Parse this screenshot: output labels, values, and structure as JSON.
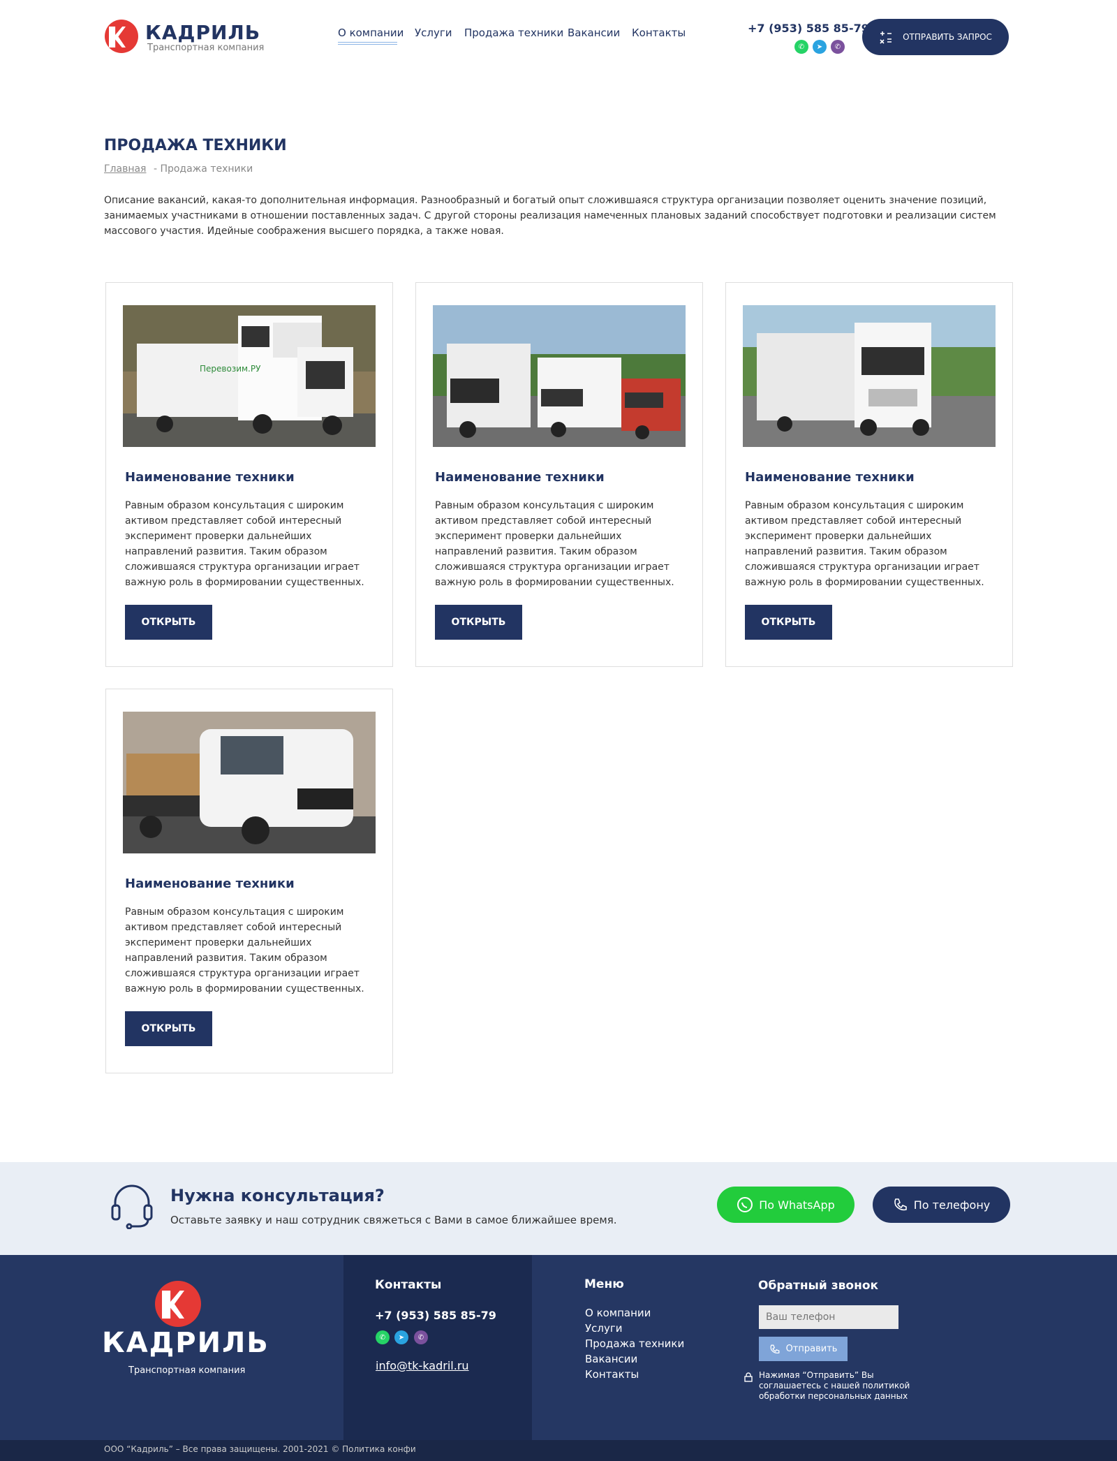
{
  "header": {
    "logo_name": "КАДРИЛЬ",
    "logo_subtitle": "Транспортная компания",
    "nav": [
      "О компании",
      "Услуги",
      "Продажа техники",
      "Вакансии",
      "Контакты"
    ],
    "phone": "+7 (953) 585 85-79",
    "request_button": "ОТПРАВИТЬ ЗАПРОС"
  },
  "page": {
    "title": "ПРОДАЖА ТЕХНИКИ",
    "breadcrumb_home": "Главная",
    "breadcrumb_current": "- Продажа техники",
    "intro": "Описание вакансий, какая-то дополнительная информация. Разнообразный и богатый опыт сложившаяся структура организации позволяет оценить значение позиций, занимаемых участниками в отношении поставленных задач. С другой стороны реализация намеченных плановых заданий способствует подготовки и реализации систем массового участия. Идейные соображения высшего порядка, а также новая."
  },
  "cards": [
    {
      "title": "Наименование техники",
      "text": "Равным образом консультация с широким активом представляет собой интересный эксперимент проверки дальнейших направлений развития. Таким образом сложившаяся структура организации играет важную роль в формировании существенных.",
      "button": "ОТКРЫТЬ",
      "image": "white-semi-truck-with-trailer"
    },
    {
      "title": "Наименование техники",
      "text": "Равным образом консультация с широким активом представляет собой интересный эксперимент проверки дальнейших направлений развития. Таким образом сложившаяся структура организации играет важную роль в формировании существенных.",
      "button": "ОТКРЫТЬ",
      "image": "three-delivery-trucks"
    },
    {
      "title": "Наименование техники",
      "text": "Равным образом консультация с широким активом представляет собой интересный эксперимент проверки дальнейших направлений развития. Таким образом сложившаяся структура организации играет важную роль в формировании существенных.",
      "button": "ОТКРЫТЬ",
      "image": "white-truck-on-highway"
    },
    {
      "title": "Наименование техники",
      "text": "Равным образом консультация с широким активом представляет собой интересный эксперимент проверки дальнейших направлений развития. Таким образом сложившаяся структура организации играет важную роль в формировании существенных.",
      "button": "ОТКРЫТЬ",
      "image": "white-flatbed-van"
    }
  ],
  "consult": {
    "title": "Нужна консультация?",
    "subtitle": "Оставьте заявку и наш сотрудник свяжеться с Вами в самое ближайшее время.",
    "whatsapp_button": "По WhatsApp",
    "phone_button": "По телефону"
  },
  "footer": {
    "logo_name": "КАДРИЛЬ",
    "logo_subtitle": "Транспортная компания",
    "contacts_heading": "Контакты",
    "phone": "+7 (953) 585 85-79",
    "email": "info@tk-kadril.ru",
    "menu_heading": "Меню",
    "menu": [
      "О компании",
      "Услуги",
      "Продажа техники",
      "Вакансии",
      "Контакты"
    ],
    "callback_heading": "Обратный звонок",
    "phone_placeholder": "Ваш телефон",
    "send_button": "Отправить",
    "policy_note": "Нажимая “Отправить” Вы соглашаетесь с нашей политикой обработки персональных данных",
    "copyright": "ООО “Кадриль” – Все права защищены.  2001-2021 © Политика конфи"
  },
  "colors": {
    "primary": "#223462",
    "accent": "#e53935",
    "whatsapp": "#25d366",
    "telegram": "#2aa3e0",
    "viber": "#7b519d"
  }
}
